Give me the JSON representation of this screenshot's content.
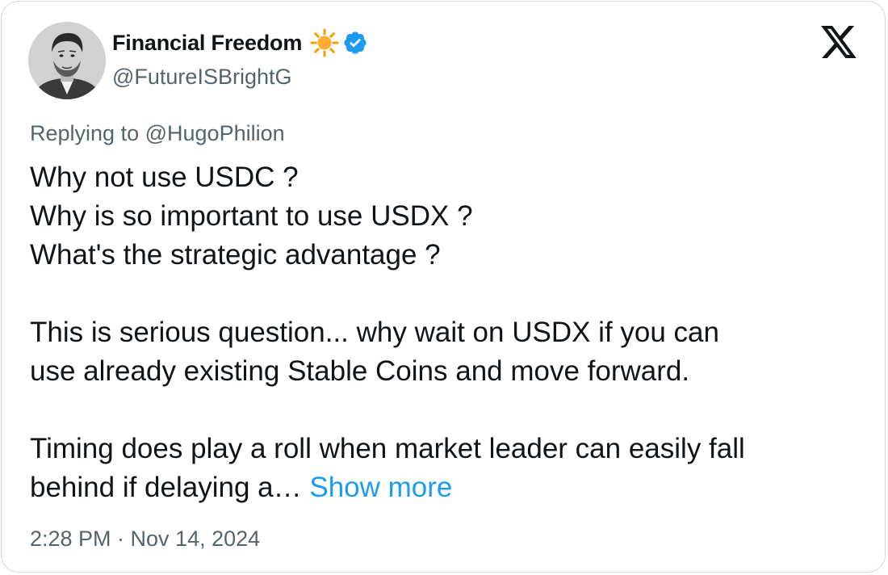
{
  "author": {
    "display_name": "Financial Freedom",
    "handle": "@FutureISBrightG",
    "badge_emoji_icon": "sun-icon",
    "verified_icon": "verified-badge-icon",
    "verified_color": "#1d9bf0"
  },
  "platform": {
    "logo_icon": "x-logo-icon"
  },
  "reply": {
    "prefix": "Replying to",
    "mention": "@HugoPhilion"
  },
  "tweet": {
    "lines": [
      "Why not use USDC ?",
      "Why is so important to use USDX ?",
      "What's the strategic advantage ?",
      "",
      "This is serious question... why wait on USDX if you can",
      "use already existing Stable Coins and move forward.",
      "",
      "Timing does play a roll when market leader can easily fall",
      "behind if delaying a…"
    ],
    "show_more": "Show more"
  },
  "meta": {
    "timestamp": "2:28 PM · Nov 14, 2024"
  },
  "colors": {
    "text": "#0f1419",
    "secondary": "#536471",
    "link": "#1d9bf0",
    "border": "#cfd9de"
  }
}
